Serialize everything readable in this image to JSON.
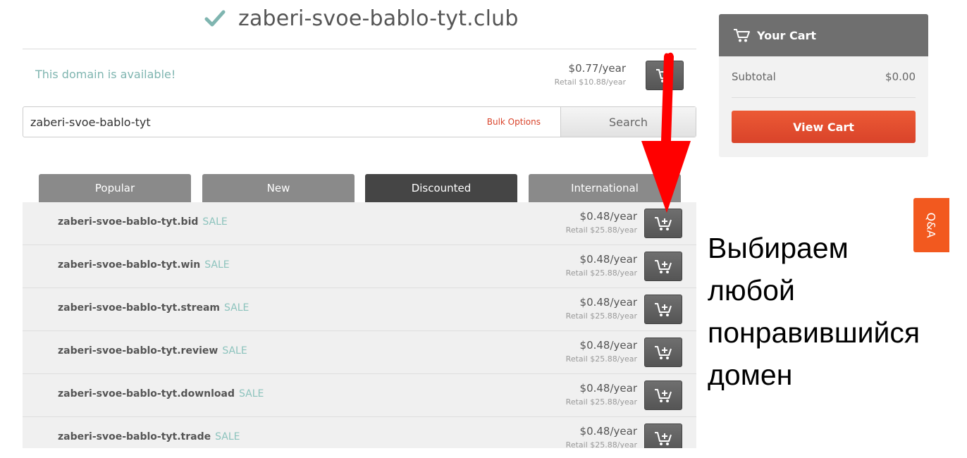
{
  "header": {
    "domain": "zaberi-svoe-bablo-tyt.club",
    "status": "This domain is available!",
    "price": "$0.77/year",
    "retail": "Retail $10.88/year"
  },
  "search": {
    "value": "zaberi-svoe-bablo-tyt",
    "bulk_label": "Bulk Options",
    "button_label": "Search"
  },
  "tabs": [
    {
      "label": "Popular",
      "active": false
    },
    {
      "label": "New",
      "active": false
    },
    {
      "label": "Discounted",
      "active": true
    },
    {
      "label": "International",
      "active": false
    }
  ],
  "results": [
    {
      "name": "zaberi-svoe-bablo-tyt.bid",
      "badge": "SALE",
      "price": "$0.48/year",
      "retail": "Retail $25.88/year"
    },
    {
      "name": "zaberi-svoe-bablo-tyt.win",
      "badge": "SALE",
      "price": "$0.48/year",
      "retail": "Retail $25.88/year"
    },
    {
      "name": "zaberi-svoe-bablo-tyt.stream",
      "badge": "SALE",
      "price": "$0.48/year",
      "retail": "Retail $25.88/year"
    },
    {
      "name": "zaberi-svoe-bablo-tyt.review",
      "badge": "SALE",
      "price": "$0.48/year",
      "retail": "Retail $25.88/year"
    },
    {
      "name": "zaberi-svoe-bablo-tyt.download",
      "badge": "SALE",
      "price": "$0.48/year",
      "retail": "Retail $25.88/year"
    },
    {
      "name": "zaberi-svoe-bablo-tyt.trade",
      "badge": "SALE",
      "price": "$0.48/year",
      "retail": "Retail $25.88/year"
    }
  ],
  "cart": {
    "title": "Your Cart",
    "subtotal_label": "Subtotal",
    "subtotal_value": "$0.00",
    "view_cart_label": "View Cart"
  },
  "annotation": {
    "lines": [
      "Выбираем",
      "любой",
      "понравившийся",
      "домен"
    ]
  },
  "qa_label": "Q&A",
  "colors": {
    "accent_red": "#d9432a",
    "available_teal": "#7fb5b0",
    "qa_orange": "#f2591f",
    "arrow_red": "#ff0000"
  },
  "icons": [
    "check-icon",
    "cart-icon",
    "cart-add-icon",
    "arrow-icon"
  ]
}
